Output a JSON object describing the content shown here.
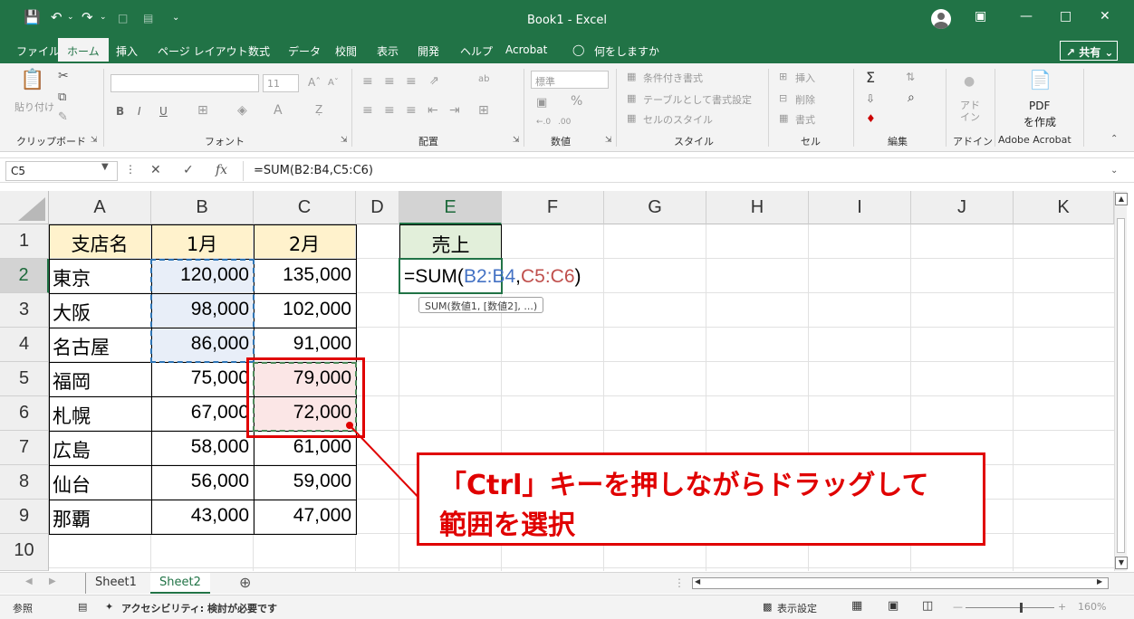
{
  "titlebar": {
    "title": "Book1  -  Excel",
    "save_icon": "save-icon",
    "undo_icon": "undo-icon",
    "redo_icon": "redo-icon"
  },
  "menu": {
    "items": [
      "ファイル",
      "ホーム",
      "挿入",
      "ページ レイアウト",
      "数式",
      "データ",
      "校閲",
      "表示",
      "開発",
      "ヘルプ",
      "Acrobat",
      "何をしますか"
    ],
    "share": "共有"
  },
  "ribbon": {
    "groups": [
      "クリップボード",
      "フォント",
      "配置",
      "数値",
      "スタイル",
      "セル",
      "編集",
      "アドイン",
      "Adobe Acrobat"
    ],
    "paste": "貼り付け",
    "font_size": "11",
    "number_format": "標準",
    "cond_format": "条件付き書式",
    "table_format": "テーブルとして書式設定",
    "cell_style": "セルのスタイル",
    "insert": "挿入",
    "delete": "削除",
    "format": "書式",
    "addin": "アド\nイン",
    "pdf": "PDF",
    "pdf_create": "を作成",
    "bold": "B",
    "italic": "I",
    "underline": "U",
    "percent": "%",
    "sigma": "Σ"
  },
  "formula_bar": {
    "name_box": "C5",
    "fx": "fx",
    "formula": "=SUM(B2:B4,C5:C6)"
  },
  "columns": [
    "A",
    "B",
    "C",
    "D",
    "E",
    "F",
    "G",
    "H",
    "I",
    "J",
    "K"
  ],
  "rows": [
    "1",
    "2",
    "3",
    "4",
    "5",
    "6",
    "7",
    "8",
    "9",
    "10"
  ],
  "table": {
    "header": [
      "支店名",
      "1月",
      "2月"
    ],
    "data": [
      [
        "東京",
        "120,000",
        "135,000"
      ],
      [
        "大阪",
        "98,000",
        "102,000"
      ],
      [
        "名古屋",
        "86,000",
        "91,000"
      ],
      [
        "福岡",
        "75,000",
        "79,000"
      ],
      [
        "札幌",
        "67,000",
        "72,000"
      ],
      [
        "広島",
        "58,000",
        "61,000"
      ],
      [
        "仙台",
        "56,000",
        "59,000"
      ],
      [
        "那覇",
        "43,000",
        "47,000"
      ]
    ]
  },
  "e1_label": "売上",
  "incell": {
    "eq": "=SUM(",
    "ref1": "B2:B4",
    "comma": ",",
    "ref2": "C5:C6",
    "close": ")",
    "ref1_color": "#4472c4",
    "ref2_color": "#c0504d"
  },
  "tooltip": "SUM(数値1, [数値2], ...)",
  "callout": {
    "line1": "「Ctrl」キーを押しながらドラッグして",
    "line2": "範囲を選択"
  },
  "sheets": [
    "Sheet1",
    "Sheet2"
  ],
  "status": {
    "mode": "参照",
    "accessibility": "アクセシビリティ: 検討が必要です",
    "display_settings": "表示設定",
    "zoom": "160%"
  },
  "colors": {
    "excel_green": "#217346",
    "callout_red": "#e00000"
  }
}
